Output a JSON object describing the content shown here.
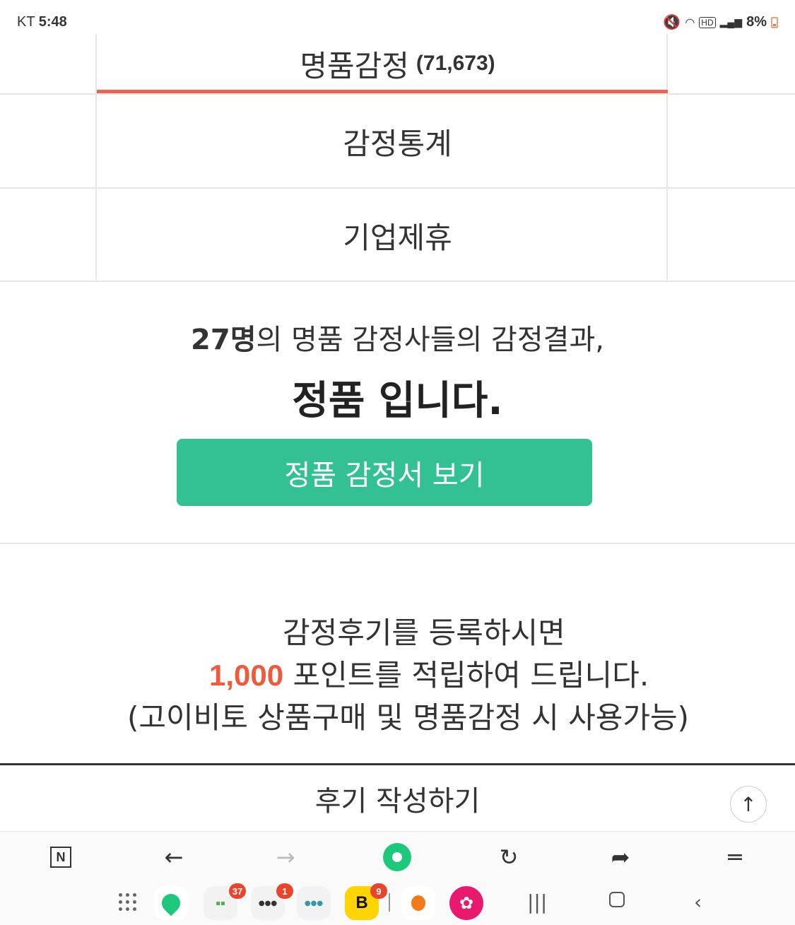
{
  "status_bar": {
    "carrier": "KT",
    "time": "5:48",
    "battery": "8%"
  },
  "menu": {
    "items": [
      {
        "label": "명품감정",
        "count": "(71,673)",
        "active": true
      },
      {
        "label": "감정통계"
      },
      {
        "label": "기업제휴"
      }
    ],
    "active_color": "#f0624d"
  },
  "result": {
    "count_text": "27명",
    "line1_rest": "의 명품 감정사들의 감정결과,",
    "verdict": "정품 입니다.",
    "button_label": "정품 감정서 보기",
    "button_color": "#33c194"
  },
  "promo": {
    "line1": "감정후기를 등록하시면",
    "points": "1,000",
    "line2_rest": " 포인트를 적립하여 드립니다.",
    "line3": "(고이비토 상품구매 및 명품감정 시 사용가능)",
    "points_color": "#ee5a3c"
  },
  "write_review": {
    "label": "후기 작성하기"
  },
  "browser_toolbar": {
    "n_label": "N",
    "icons": [
      "n-home-icon",
      "back-arrow-icon",
      "forward-arrow-icon",
      "naver-green-dot-icon",
      "refresh-icon",
      "share-icon",
      "menu-lines-icon"
    ]
  },
  "dock": {
    "badges": {
      "folder1": "37",
      "folder2": "1",
      "bookmark_app": "9"
    },
    "bookmark_letter": "B"
  }
}
